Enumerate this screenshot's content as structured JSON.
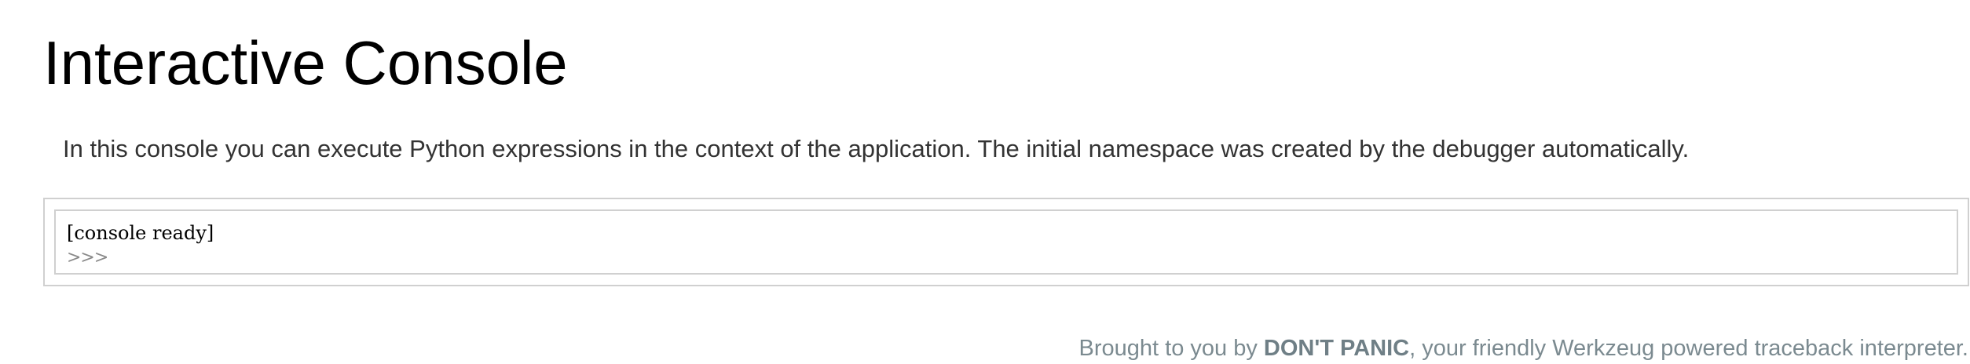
{
  "header": {
    "title": "Interactive Console"
  },
  "explanation": {
    "text": "In this console you can execute Python expressions in the context of the application. The initial namespace was created by the debugger automatically."
  },
  "console": {
    "output": "[console ready]",
    "prompt": ">>>",
    "input_value": ""
  },
  "footer": {
    "prefix": "Brought to you by ",
    "strong": "DON'T PANIC",
    "suffix": ", your friendly Werkzeug powered traceback interpreter."
  },
  "colors": {
    "title_text": "#000000",
    "body_text": "#333333",
    "console_border": "#d0d0d0",
    "prompt_text": "#8a8a8a",
    "footer_text": "#7b8a90"
  }
}
